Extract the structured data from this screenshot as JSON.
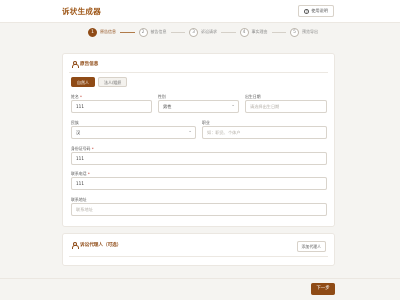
{
  "header": {
    "brand": "诉状生成器",
    "help_label": "使用说明"
  },
  "steps": [
    {
      "num": "1",
      "label": "原告信息"
    },
    {
      "num": "2",
      "label": "被告信息"
    },
    {
      "num": "3",
      "label": "诉讼请求"
    },
    {
      "num": "4",
      "label": "事实理由"
    },
    {
      "num": "5",
      "label": "预览导出"
    }
  ],
  "plaintiff": {
    "title": "原告信息",
    "types": [
      "自然人",
      "法人/组织"
    ],
    "name": {
      "label": "姓名",
      "value": "111"
    },
    "gender": {
      "label": "性别",
      "value": "男性"
    },
    "birthdate": {
      "label": "出生日期",
      "placeholder": "请选择出生日期"
    },
    "ethnicity": {
      "label": "民族",
      "value": "汉"
    },
    "occupation": {
      "label": "职业",
      "placeholder": "如：职员、个体户"
    },
    "id_number": {
      "label": "身份证号码",
      "value": "111"
    },
    "phone": {
      "label": "联系电话",
      "value": "111"
    },
    "address": {
      "label": "联系地址",
      "placeholder": "联系地址"
    }
  },
  "agent": {
    "title": "诉讼代理人（可选）",
    "add_label": "添加代理人"
  },
  "footer": {
    "next_label": "下一步"
  }
}
